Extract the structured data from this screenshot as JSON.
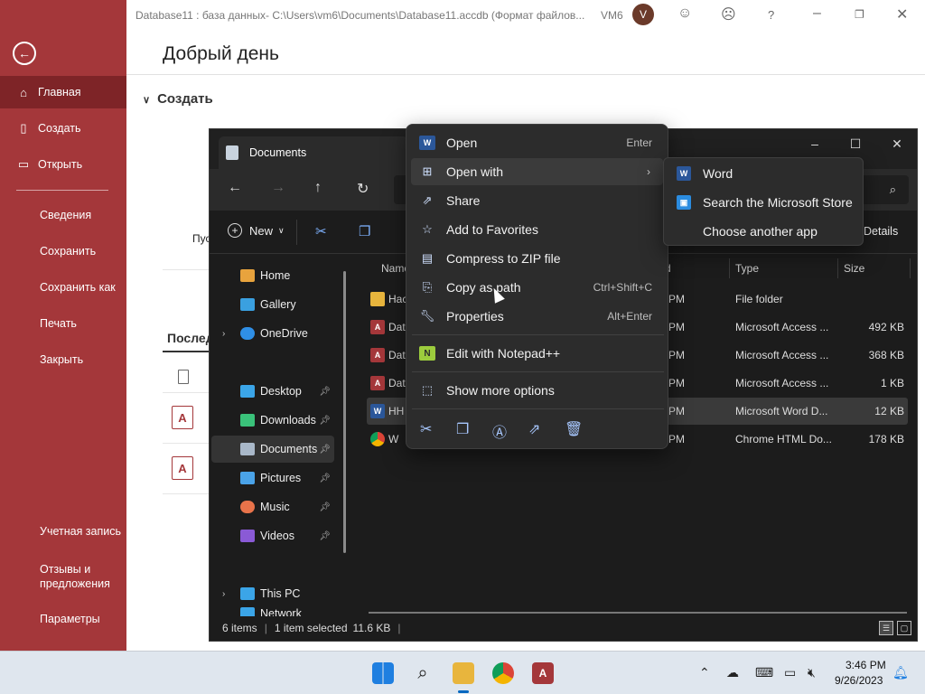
{
  "access": {
    "title": "Database11 : база данных- C:\\Users\\vm6\\Documents\\Database11.accdb (Формат файлов...",
    "user_initials": "VM6",
    "avatar_letter": "V",
    "greeting": "Добрый день",
    "create_heading": "Создать",
    "template_label": "Пус",
    "recent_heading": "Послед",
    "sidebar": {
      "items": [
        {
          "label": "Главная",
          "icon": "home-icon"
        },
        {
          "label": "Создать",
          "icon": "new-file-icon"
        },
        {
          "label": "Открыть",
          "icon": "open-folder-icon"
        },
        {
          "label": "Сведения"
        },
        {
          "label": "Сохранить"
        },
        {
          "label": "Сохранить как"
        },
        {
          "label": "Печать"
        },
        {
          "label": "Закрыть"
        },
        {
          "label": "Учетная запись"
        },
        {
          "label": "Отзывы и предложения"
        },
        {
          "label": "Параметры"
        }
      ]
    },
    "accent_color": "#a4373a"
  },
  "explorer": {
    "title": "Documents",
    "toolbar": {
      "new_label": "New",
      "details_label": "Details"
    },
    "nav": [
      {
        "label": "Home",
        "color": "#e8a33d"
      },
      {
        "label": "Gallery",
        "color": "#3aa0e0"
      },
      {
        "label": "OneDrive",
        "color": "#2f8fe6"
      },
      {
        "label": "Desktop",
        "color": "#3ba5e8"
      },
      {
        "label": "Downloads",
        "color": "#3ac27a"
      },
      {
        "label": "Documents",
        "color": "#a9b8c9"
      },
      {
        "label": "Pictures",
        "color": "#4aa3e8"
      },
      {
        "label": "Music",
        "color": "#e8734a"
      },
      {
        "label": "Videos",
        "color": "#8a5ad6"
      },
      {
        "label": "This PC",
        "color": "#3ba5e8"
      },
      {
        "label": "Network",
        "color": "#3ba5e8"
      }
    ],
    "columns": {
      "name": "Name",
      "date": "d",
      "type": "Type",
      "size": "Size"
    },
    "files": [
      {
        "name": "Hac",
        "date": "7 PM",
        "type": "File folder",
        "size": "",
        "icon": "folder-icon",
        "color": "#e8b53d",
        "glyph": ""
      },
      {
        "name": "Dat",
        "date": "6 PM",
        "type": "Microsoft Access ...",
        "size": "492 KB",
        "icon": "access-file-icon",
        "color": "#a4373a",
        "glyph": "A"
      },
      {
        "name": "Dat",
        "date": "6 PM",
        "type": "Microsoft Access ...",
        "size": "368 KB",
        "icon": "access-file-icon",
        "color": "#a4373a",
        "glyph": "A"
      },
      {
        "name": "Dat",
        "date": "6 PM",
        "type": "Microsoft Access ...",
        "size": "1 KB",
        "icon": "access-lock-file-icon",
        "color": "#a4373a",
        "glyph": "A"
      },
      {
        "name": "HH",
        "date": "7 PM",
        "type": "Microsoft Word D...",
        "size": "12 KB",
        "icon": "word-file-icon",
        "color": "#2b579a",
        "glyph": "W"
      },
      {
        "name": "W",
        "date": "8 PM",
        "type": "Chrome HTML Do...",
        "size": "178 KB",
        "icon": "chrome-file-icon",
        "color": "#db4437",
        "glyph": ""
      }
    ],
    "status": {
      "items_count": "6 items",
      "selected": "1 item selected",
      "selected_size": "11.6 KB"
    }
  },
  "context_menu": {
    "items": [
      {
        "label": "Open",
        "shortcut": "Enter",
        "icon": "word-icon"
      },
      {
        "label": "Open with",
        "shortcut": "",
        "icon": "open-with-icon"
      },
      {
        "label": "Share",
        "shortcut": "",
        "icon": "share-icon"
      },
      {
        "label": "Add to Favorites",
        "shortcut": "",
        "icon": "star-icon"
      },
      {
        "label": "Compress to ZIP file",
        "shortcut": "",
        "icon": "zip-icon"
      },
      {
        "label": "Copy as path",
        "shortcut": "Ctrl+Shift+C",
        "icon": "copy-path-icon"
      },
      {
        "label": "Properties",
        "shortcut": "Alt+Enter",
        "icon": "properties-icon"
      },
      {
        "label": "Edit with Notepad++",
        "shortcut": "",
        "icon": "notepad-plus-icon"
      },
      {
        "label": "Show more options",
        "shortcut": "",
        "icon": "more-options-icon"
      }
    ],
    "actions": [
      "cut-icon",
      "copy-icon",
      "rename-icon",
      "share-icon",
      "delete-icon"
    ]
  },
  "submenu": {
    "items": [
      {
        "label": "Word",
        "icon": "word-icon",
        "color": "#2b579a",
        "glyph": "W"
      },
      {
        "label": "Search the Microsoft Store",
        "icon": "store-icon",
        "color": "#2b8ce0",
        "glyph": "▣"
      },
      {
        "label": "Choose another app",
        "icon": "",
        "color": "",
        "glyph": ""
      }
    ]
  },
  "taskbar": {
    "time": "3:46 PM",
    "date": "9/26/2023"
  }
}
